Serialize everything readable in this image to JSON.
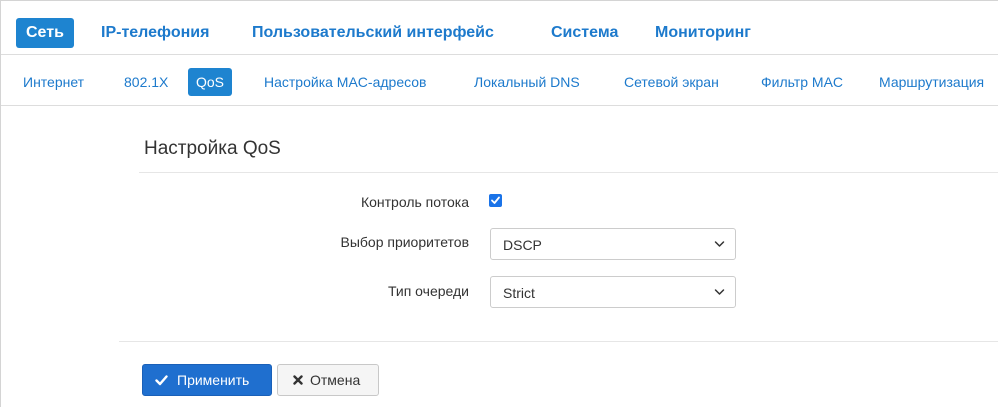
{
  "topnav": {
    "items": [
      {
        "label": "Сеть",
        "active": true
      },
      {
        "label": "IP-телефония",
        "active": false
      },
      {
        "label": "Пользовательский интерфейс",
        "active": false
      },
      {
        "label": "Система",
        "active": false
      },
      {
        "label": "Мониторинг",
        "active": false
      }
    ]
  },
  "subnav": {
    "items": [
      {
        "label": "Интернет",
        "active": false
      },
      {
        "label": "802.1X",
        "active": false
      },
      {
        "label": "QoS",
        "active": true
      },
      {
        "label": "Настройка MAC-адресов",
        "active": false
      },
      {
        "label": "Локальный DNS",
        "active": false
      },
      {
        "label": "Сетевой экран",
        "active": false
      },
      {
        "label": "Фильтр MAC",
        "active": false
      },
      {
        "label": "Маршрутизация",
        "active": false
      }
    ]
  },
  "form": {
    "title": "Настройка QoS",
    "flow_control": {
      "label": "Контроль потока",
      "checked": true
    },
    "priority": {
      "label": "Выбор приоритетов",
      "value": "DSCP"
    },
    "queue": {
      "label": "Тип очереди",
      "value": "Strict"
    }
  },
  "buttons": {
    "apply": "Применить",
    "cancel": "Отмена"
  },
  "colors": {
    "accent": "#1e84d0",
    "link": "#1d7acc",
    "primary_button": "#1f6fcf"
  }
}
